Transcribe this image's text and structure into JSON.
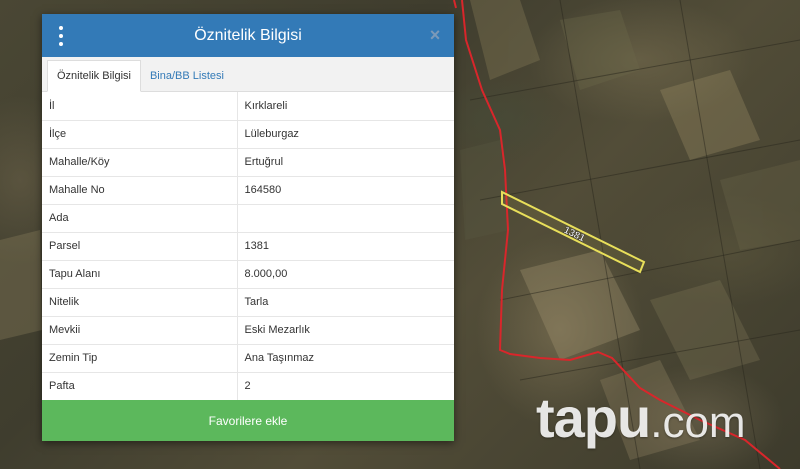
{
  "dialog": {
    "title": "Öznitelik Bilgisi",
    "tabs": [
      {
        "label": "Öznitelik Bilgisi",
        "active": true
      },
      {
        "label": "Bina/BB Listesi",
        "active": false
      }
    ],
    "rows": [
      {
        "key": "İl",
        "value": "Kırklareli"
      },
      {
        "key": "İlçe",
        "value": "Lüleburgaz"
      },
      {
        "key": "Mahalle/Köy",
        "value": "Ertuğrul"
      },
      {
        "key": "Mahalle No",
        "value": "164580"
      },
      {
        "key": "Ada",
        "value": ""
      },
      {
        "key": "Parsel",
        "value": "1381"
      },
      {
        "key": "Tapu Alanı",
        "value": "8.000,00"
      },
      {
        "key": "Nitelik",
        "value": "Tarla"
      },
      {
        "key": "Mevkii",
        "value": "Eski Mezarlık"
      },
      {
        "key": "Zemin Tip",
        "value": "Ana Taşınmaz"
      },
      {
        "key": "Pafta",
        "value": "2"
      }
    ],
    "favorite_button": "Favorilere ekle"
  },
  "map": {
    "parcel_label": "1381",
    "boundary_color": "#d9262b",
    "parcel_color": "#e8df5a"
  },
  "watermark": {
    "brand": "tapu",
    "suffix": ".com"
  }
}
